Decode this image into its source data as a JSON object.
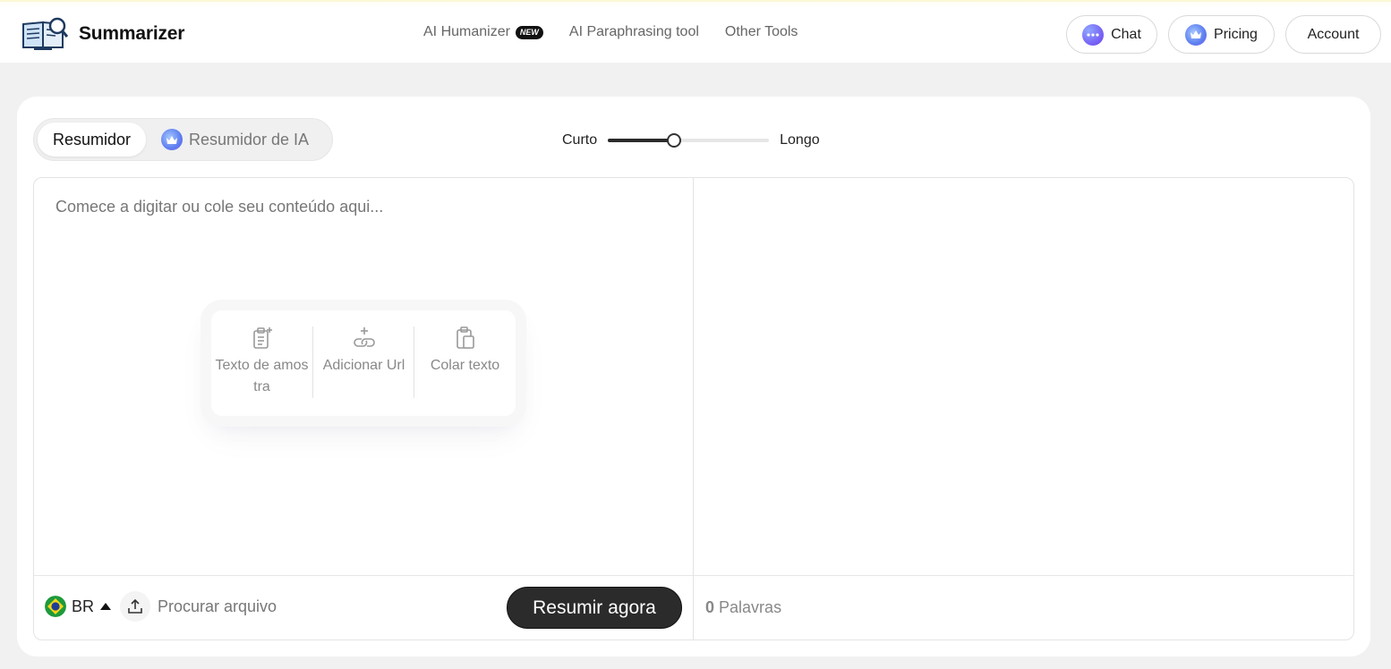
{
  "header": {
    "logo_text": "Summarizer",
    "nav": [
      {
        "label": "AI Humanizer",
        "badge": "NEW"
      },
      {
        "label": "AI Paraphrasing tool"
      },
      {
        "label": "Other Tools"
      }
    ],
    "buttons": {
      "chat": "Chat",
      "pricing": "Pricing",
      "account": "Account"
    }
  },
  "mode": {
    "active": "Resumidor",
    "ai": "Resumidor de IA"
  },
  "length": {
    "short_label": "Curto",
    "long_label": "Longo",
    "value": 0.41
  },
  "input": {
    "placeholder": "Comece a digitar ou cole seu conteúdo aqui...",
    "quick_actions": [
      {
        "label": "Texto de amos tra",
        "icon": "sample-text-icon"
      },
      {
        "label": "Adicionar Url",
        "icon": "add-url-icon"
      },
      {
        "label": "Colar texto",
        "icon": "paste-icon"
      }
    ]
  },
  "footer": {
    "language": "BR",
    "upload_label": "Procurar arquivo",
    "submit_label": "Resumir agora",
    "word_count": "0",
    "word_label": "Palavras"
  },
  "colors": {
    "accent_dark": "#2b2b2b",
    "background": "#f1f1f1"
  }
}
